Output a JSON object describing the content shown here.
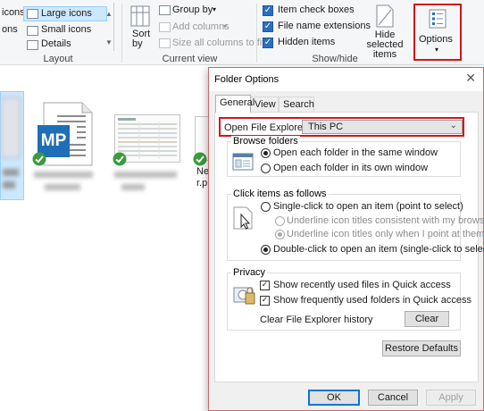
{
  "ribbon": {
    "layout": {
      "row1_left": "icons",
      "row2_left": "ons",
      "large_icons": "Large icons",
      "small_icons": "Small icons",
      "details": "Details",
      "group_label": "Layout"
    },
    "current_view": {
      "sort_by": "Sort by",
      "group_by": "Group by",
      "add_columns": "Add columns",
      "size_all_columns": "Size all columns to fit",
      "group_label": "Current view"
    },
    "show_hide": {
      "item_check_boxes": "Item check boxes",
      "file_name_extensions": "File name extensions",
      "hidden_items": "Hidden items",
      "hide_selected_items": "Hide selected items",
      "group_label": "Show/hide"
    },
    "options": {
      "label": "Options"
    }
  },
  "files": {
    "mp_badge": "MP",
    "partial_name_line1": "Ne",
    "partial_name_line2": "r.p"
  },
  "dialog": {
    "title": "Folder Options",
    "tabs": [
      "General",
      "View",
      "Search"
    ],
    "open_label": "Open File Explorer to:",
    "open_value": "This PC",
    "browse": {
      "title": "Browse folders",
      "option_same": "Open each folder in the same window",
      "option_own": "Open each folder in its own window"
    },
    "click": {
      "title": "Click items as follows",
      "single": "Single-click to open an item (point to select)",
      "underline_consistent": "Underline icon titles consistent with my browser",
      "underline_point": "Underline icon titles only when I point at them",
      "double": "Double-click to open an item (single-click to select)"
    },
    "privacy": {
      "title": "Privacy",
      "recent_files": "Show recently used files in Quick access",
      "frequent_folders": "Show frequently used folders in Quick access",
      "clear_history": "Clear File Explorer history",
      "clear_button": "Clear"
    },
    "restore_defaults": "Restore Defaults",
    "ok": "OK",
    "cancel": "Cancel",
    "apply": "Apply"
  },
  "colors": {
    "highlight_red": "#d2141d",
    "checkbox_blue": "#2b6fc2",
    "sync_green": "#3c9b3c",
    "mp_blue": "#1f6fb7"
  }
}
